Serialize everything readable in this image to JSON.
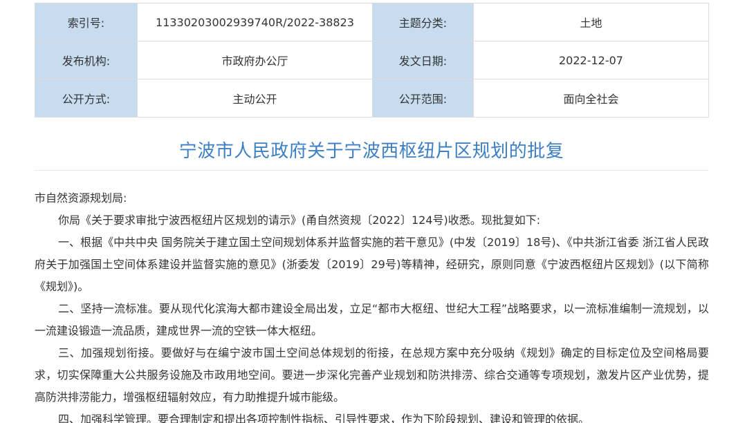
{
  "meta": {
    "index_label": "索引号:",
    "index_value": "11330203002939740R/2022-38823",
    "category_label": "主题分类:",
    "category_value": "土地",
    "issuer_label": "发布机构:",
    "issuer_value": "市政府办公厅",
    "date_label": "发文日期:",
    "date_value": "2022-12-07",
    "mode_label": "公开方式:",
    "mode_value": "主动公开",
    "scope_label": "公开范围:",
    "scope_value": "面向全社会"
  },
  "document": {
    "title": "宁波市人民政府关于宁波西枢纽片区规划的批复",
    "salutation": "市自然资源规划局:",
    "paragraphs": [
      "你局《关于要求审批宁波西枢纽片区规划的请示》(甬自然资规〔2022〕124号)收悉。现批复如下:",
      "一、根据《中共中央 国务院关于建立国土空间规划体系并监督实施的若干意见》(中发〔2019〕18号)、《中共浙江省委 浙江省人民政府关于加强国土空间体系建设并监督实施的意见》(浙委发〔2019〕29号)等精神，经研究，原则同意《宁波西枢纽片区规划》(以下简称《规划》)。",
      "二、坚持一流标准。要从现代化滨海大都市建设全局出发，立足“都市大枢纽、世纪大工程”战略要求，以一流标准编制一流规划，以一流建设锻造一流品质，建成世界一流的空铁一体大枢纽。",
      "三、加强规划衔接。要做好与在编宁波市国土空间总体规划的衔接，在总规方案中充分吸纳《规划》确定的目标定位及空间格局要求，切实保障重大公共服务设施及市政用地空间。要进一步深化完善产业规划和防洪排涝、综合交通等专项规划，激发片区产业优势，提高防洪排涝能力，增强枢纽辐射效应，有力助推提升城市能级。",
      "四、加强科学管理。要合理制定和提出各项控制性指标、引导性要求，作为下阶段规划、建设和管理的依据。"
    ]
  }
}
